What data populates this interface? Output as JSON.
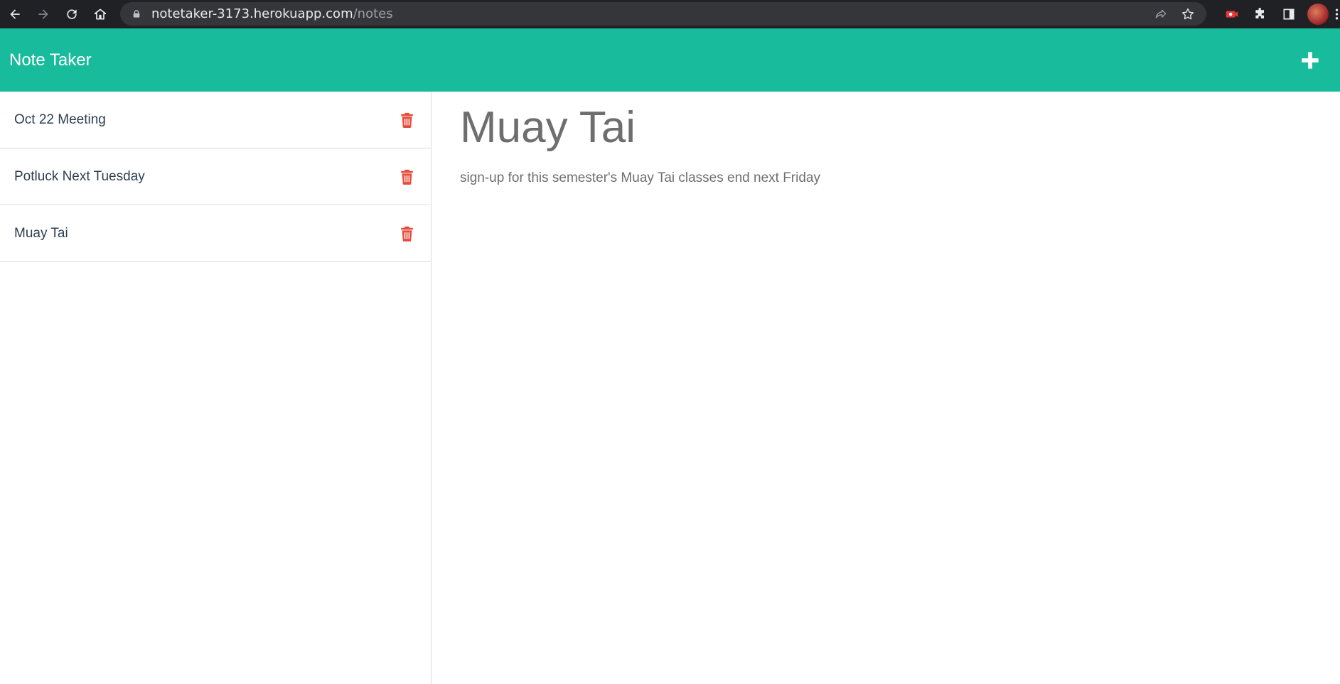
{
  "browser": {
    "url_host": "notetaker-3173.herokuapp.com",
    "url_path": "/notes"
  },
  "app": {
    "title": "Note Taker",
    "accent_color": "#18bc9c",
    "delete_color": "#e74c3c"
  },
  "notes": [
    {
      "title": "Oct 22 Meeting"
    },
    {
      "title": "Potluck Next Tuesday"
    },
    {
      "title": "Muay Tai"
    }
  ],
  "active_note": {
    "title": "Muay Tai",
    "text": "sign-up for this semester's Muay Tai classes end next Friday"
  },
  "icons": {
    "back": "arrow-left-icon",
    "forward": "arrow-right-icon",
    "reload": "reload-icon",
    "home": "home-icon",
    "lock": "lock-icon",
    "share": "share-icon",
    "bookmark": "star-icon",
    "extension": "puzzle-icon",
    "sidepanel": "side-panel-icon",
    "new_note": "plus-icon",
    "delete": "trash-icon"
  }
}
